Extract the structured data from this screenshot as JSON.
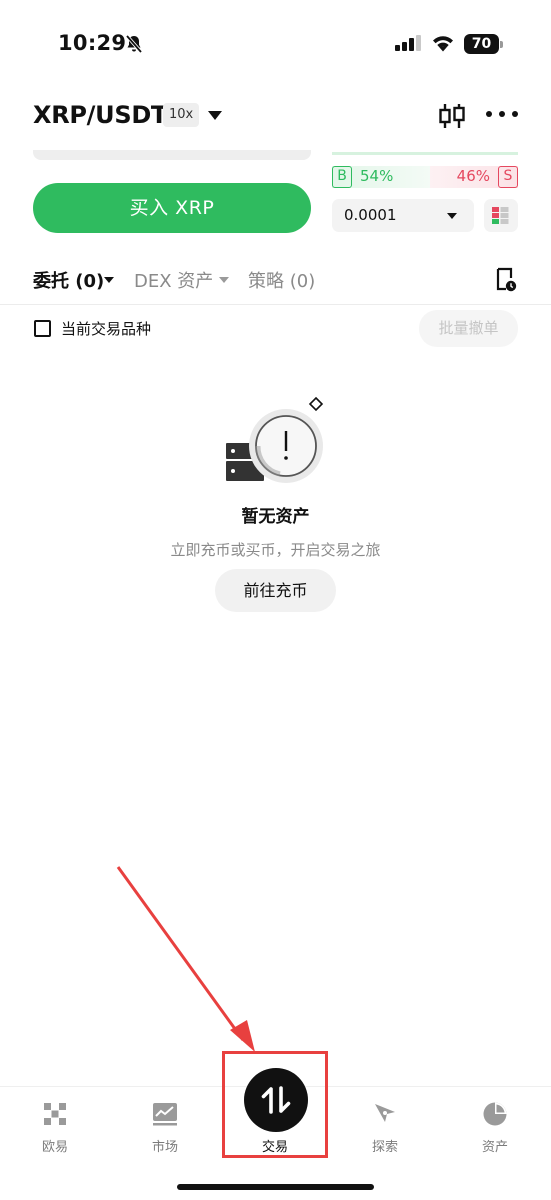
{
  "status_bar": {
    "time": "10:29",
    "battery": "70"
  },
  "header": {
    "pair": "XRP/USDT",
    "leverage": "10x"
  },
  "trade": {
    "buy_button": "买入 XRP",
    "ratio": {
      "buy_tag": "B",
      "buy_pct": "54%",
      "sell_pct": "46%",
      "sell_tag": "S"
    },
    "precision": "0.0001"
  },
  "tabs": {
    "orders": "委托 (0)",
    "dex": "DEX 资产",
    "strategy": "策略 (0)"
  },
  "filter": {
    "current_only": "当前交易品种",
    "batch_cancel": "批量撤单"
  },
  "empty": {
    "title": "暂无资产",
    "subtitle": "立即充币或买币，开启交易之旅",
    "button": "前往充币"
  },
  "bottom_nav": {
    "items": [
      {
        "label": "欧易",
        "icon": "okx-logo-icon"
      },
      {
        "label": "市场",
        "icon": "market-chart-icon"
      },
      {
        "label": "交易",
        "icon": "trade-swap-icon",
        "active": true
      },
      {
        "label": "探索",
        "icon": "compass-icon"
      },
      {
        "label": "资产",
        "icon": "pie-chart-icon"
      }
    ]
  },
  "colors": {
    "buy_green": "#2fbb5f",
    "sell_red": "#e5485f",
    "annotation_red": "#e8403f"
  }
}
